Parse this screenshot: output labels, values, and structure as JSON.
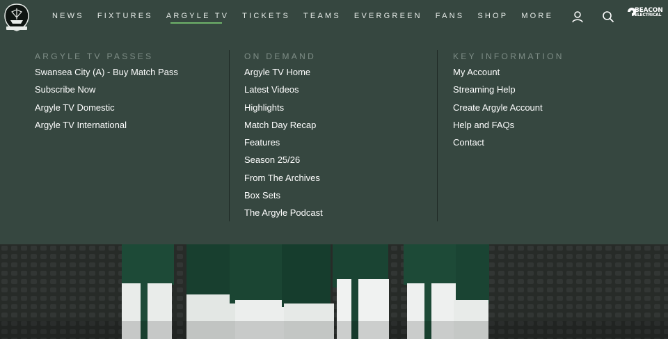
{
  "nav": {
    "items": [
      {
        "label": "NEWS"
      },
      {
        "label": "FIXTURES"
      },
      {
        "label": "ARGYLE TV"
      },
      {
        "label": "TICKETS"
      },
      {
        "label": "TEAMS"
      },
      {
        "label": "EVERGREEN"
      },
      {
        "label": "FANS"
      },
      {
        "label": "SHOP"
      },
      {
        "label": "MORE"
      }
    ],
    "active": "ARGYLE TV"
  },
  "sponsor": {
    "line1": "BEACON",
    "line2": "ELECTRICAL"
  },
  "menu": {
    "columns": [
      {
        "heading": "ARGYLE TV PASSES",
        "links": [
          "Swansea City (A) - Buy Match Pass",
          "Subscribe Now",
          "Argyle TV Domestic",
          "Argyle TV International"
        ]
      },
      {
        "heading": "ON DEMAND",
        "links": [
          "Argyle TV Home",
          "Latest Videos",
          "Highlights",
          "Match Day Recap",
          "Features",
          "Season 25/26",
          "From The Archives",
          "Box Sets",
          "The Argyle Podcast"
        ]
      },
      {
        "heading": "KEY INFORMATION",
        "links": [
          "My Account",
          "Streaming Help",
          "Create Argyle Account",
          "Help and FAQs",
          "Contact"
        ]
      }
    ]
  },
  "icons": {
    "account": "user-icon",
    "search": "search-icon"
  },
  "colors": {
    "panel": "#364740",
    "accent": "#6fb36a",
    "heading": "#7f8e87"
  }
}
